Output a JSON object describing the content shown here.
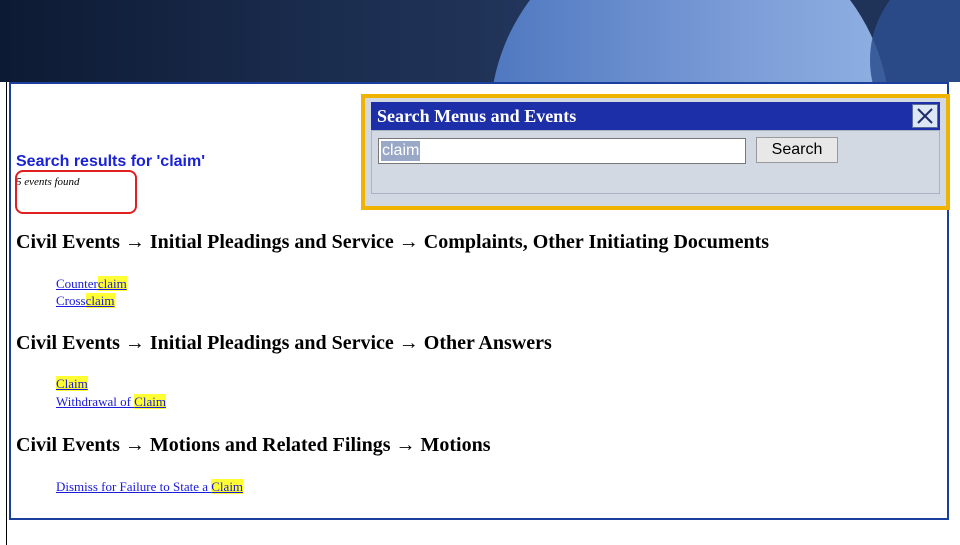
{
  "search_results_title": "Search results for 'claim'",
  "events_found": "5 events found",
  "dialog": {
    "title": "Search Menus and Events",
    "search_value": "claim",
    "search_button": "Search"
  },
  "sections": [
    {
      "heading": "Civil Events → Initial Pleadings and Service → Complaints, Other Initiating Documents",
      "links": [
        {
          "pre": "Counter",
          "hl": "claim"
        },
        {
          "pre": "Cross",
          "hl": "claim"
        }
      ]
    },
    {
      "heading": "Civil Events → Initial Pleadings and Service → Other Answers",
      "links": [
        {
          "pre": "",
          "hl": "Claim"
        },
        {
          "pre": "Withdrawal of ",
          "hl": "Claim"
        }
      ]
    },
    {
      "heading": "Civil Events → Motions and Related Filings → Motions",
      "links": [
        {
          "pre": "Dismiss for Failure to State a ",
          "hl": "Claim"
        }
      ]
    }
  ],
  "colors": {
    "accent_blue": "#1a3f9c",
    "highlight_yellow": "#ffff33",
    "callout_red": "#e02020",
    "callout_gold": "#f0b400"
  }
}
